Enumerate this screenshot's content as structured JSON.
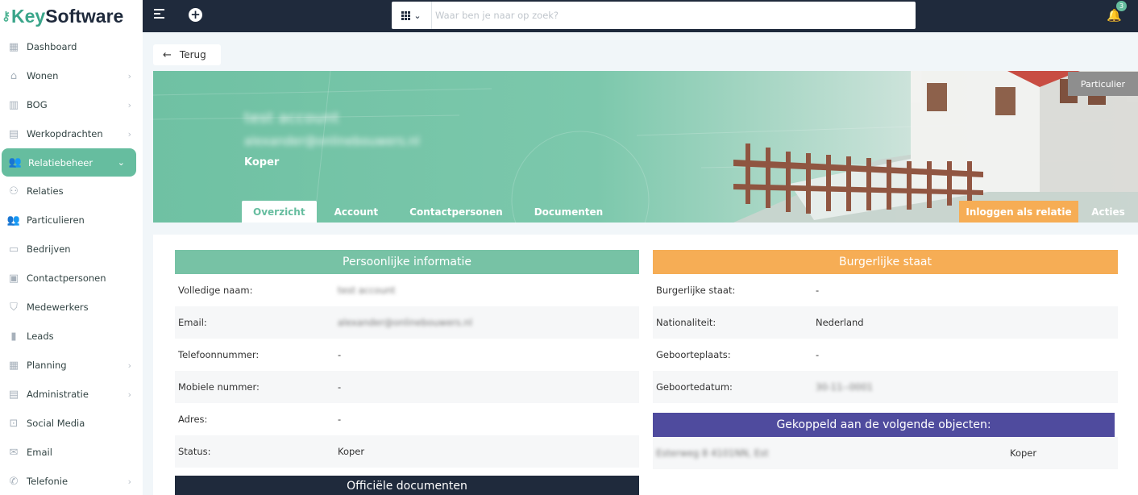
{
  "logo": {
    "key": "Key",
    "software": "Software"
  },
  "sidebar": {
    "items": [
      {
        "label": "Dashboard",
        "icon": "dashboard-icon",
        "glyph": "▦",
        "chevron": false,
        "active": false
      },
      {
        "label": "Wonen",
        "icon": "home-icon",
        "glyph": "⌂",
        "chevron": true,
        "active": false
      },
      {
        "label": "BOG",
        "icon": "building-icon",
        "glyph": "▥",
        "chevron": true,
        "active": false
      },
      {
        "label": "Werkopdrachten",
        "icon": "clipboard-icon",
        "glyph": "▤",
        "chevron": true,
        "active": false
      },
      {
        "label": "Relatiebeheer",
        "icon": "users-icon",
        "glyph": "👥",
        "chevron": true,
        "active": true
      },
      {
        "label": "Relaties",
        "icon": "users-outline-icon",
        "glyph": "⚇",
        "chevron": false,
        "active": false
      },
      {
        "label": "Particulieren",
        "icon": "people-icon",
        "glyph": "👥",
        "chevron": false,
        "active": false
      },
      {
        "label": "Bedrijven",
        "icon": "store-icon",
        "glyph": "▭",
        "chevron": false,
        "active": false
      },
      {
        "label": "Contactpersonen",
        "icon": "id-card-icon",
        "glyph": "▣",
        "chevron": false,
        "active": false
      },
      {
        "label": "Medewerkers",
        "icon": "shield-icon",
        "glyph": "⛉",
        "chevron": false,
        "active": false
      },
      {
        "label": "Leads",
        "icon": "bar-chart-icon",
        "glyph": "▮",
        "chevron": false,
        "active": false
      },
      {
        "label": "Planning",
        "icon": "calendar-icon",
        "glyph": "▦",
        "chevron": true,
        "active": false
      },
      {
        "label": "Administratie",
        "icon": "ledger-icon",
        "glyph": "▤",
        "chevron": true,
        "active": false
      },
      {
        "label": "Social Media",
        "icon": "share-icon",
        "glyph": "⊡",
        "chevron": false,
        "active": false
      },
      {
        "label": "Email",
        "icon": "envelope-icon",
        "glyph": "✉",
        "chevron": false,
        "active": false
      },
      {
        "label": "Telefonie",
        "icon": "phone-icon",
        "glyph": "✆",
        "chevron": true,
        "active": false
      }
    ]
  },
  "topbar": {
    "search_placeholder": "Waar ben je naar op zoek?",
    "notification_count": "3"
  },
  "back": {
    "label": "Terug"
  },
  "hero": {
    "name": "test account",
    "email": "alexander@onlinebouwers.nl",
    "role": "Koper",
    "badge": "Particulier",
    "tabs": [
      "Overzicht",
      "Account",
      "Contactpersonen",
      "Documenten"
    ],
    "login_button": "Inloggen als relatie",
    "actions_button": "Acties"
  },
  "personal": {
    "title": "Persoonlijke informatie",
    "rows": [
      {
        "label": "Volledige naam:",
        "value": "test account",
        "blurred": true
      },
      {
        "label": "Email:",
        "value": "alexander@onlinebouwers.nl",
        "blurred": true
      },
      {
        "label": "Telefoonnummer:",
        "value": "-",
        "blurred": false
      },
      {
        "label": "Mobiele nummer:",
        "value": "-",
        "blurred": false
      },
      {
        "label": "Adres:",
        "value": "-",
        "blurred": false
      },
      {
        "label": "Status:",
        "value": "Koper",
        "blurred": false
      }
    ]
  },
  "civil": {
    "title": "Burgerlijke staat",
    "rows": [
      {
        "label": "Burgerlijke staat:",
        "value": "-",
        "blurred": false
      },
      {
        "label": "Nationaliteit:",
        "value": "Nederland",
        "blurred": false
      },
      {
        "label": "Geboorteplaats:",
        "value": "-",
        "blurred": false
      },
      {
        "label": "Geboortedatum:",
        "value": "30-11--0001",
        "blurred": true
      }
    ]
  },
  "objects": {
    "title": "Gekoppeld aan de volgende objecten:",
    "rows": [
      {
        "address": "Esterweg 8 4101NN, Est",
        "role": "Koper"
      }
    ]
  },
  "documents": {
    "title": "Officiële documenten"
  },
  "colors": {
    "accent": "#66bd9f",
    "orange": "#f6ad55",
    "navy": "#1f2a3c",
    "purple": "#4f4b9e"
  }
}
